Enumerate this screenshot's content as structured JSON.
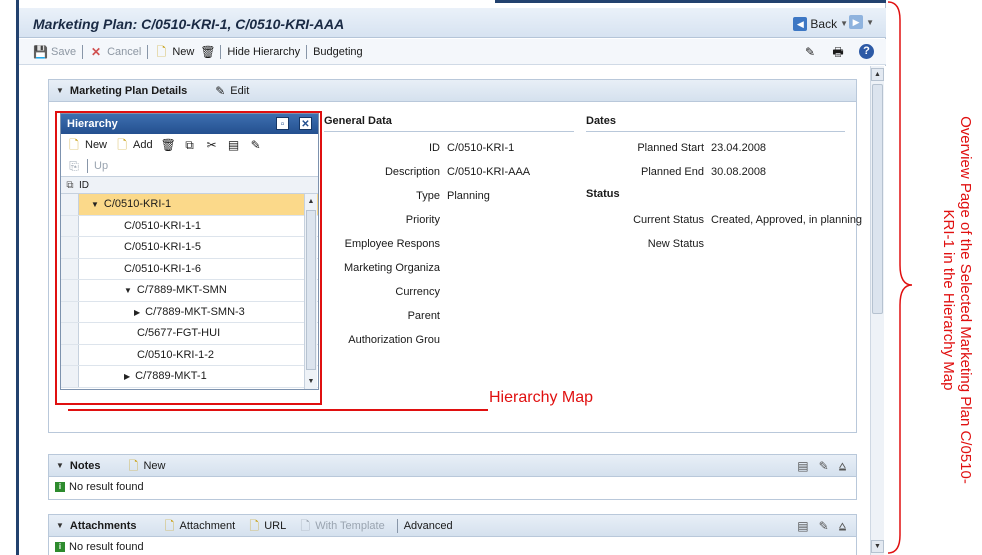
{
  "window": {
    "title": "Marketing Plan: C/0510-KRI-1, C/0510-KRI-AAA",
    "back_label": "Back"
  },
  "toolbar": {
    "save_label": "Save",
    "cancel_label": "Cancel",
    "new_label": "New",
    "hide_hierarchy_label": "Hide Hierarchy",
    "budgeting_label": "Budgeting"
  },
  "details_panel": {
    "title": "Marketing Plan Details",
    "edit_label": "Edit",
    "general_data_title": "General Data",
    "dates_title": "Dates",
    "status_title": "Status",
    "general_fields": [
      {
        "label": "ID",
        "value": "C/0510-KRI-1"
      },
      {
        "label": "Description",
        "value": "C/0510-KRI-AAA"
      },
      {
        "label": "Type",
        "value": "Planning"
      },
      {
        "label": "Priority",
        "value": ""
      },
      {
        "label": "Employee Respons",
        "value": ""
      },
      {
        "label": "Marketing Organiza",
        "value": ""
      },
      {
        "label": "Currency",
        "value": ""
      },
      {
        "label": "Parent",
        "value": ""
      },
      {
        "label": "Authorization Grou",
        "value": ""
      }
    ],
    "date_fields": [
      {
        "label": "Planned Start",
        "value": "23.04.2008"
      },
      {
        "label": "Planned End",
        "value": "30.08.2008"
      }
    ],
    "status_fields": [
      {
        "label": "Current Status",
        "value": "Created, Approved, in planning"
      },
      {
        "label": "New Status",
        "value": ""
      }
    ]
  },
  "hierarchy": {
    "title": "Hierarchy",
    "new_label": "New",
    "add_label": "Add",
    "up_label": "Up",
    "column_header": "ID",
    "rows": [
      {
        "text": "C/0510-KRI-1",
        "arrow": "▼",
        "level": 1,
        "selected": true
      },
      {
        "text": "C/0510-KRI-1-1",
        "arrow": "",
        "level": 2,
        "selected": false
      },
      {
        "text": "C/0510-KRI-1-5",
        "arrow": "",
        "level": 2,
        "selected": false
      },
      {
        "text": "C/0510-KRI-1-6",
        "arrow": "",
        "level": 2,
        "selected": false
      },
      {
        "text": "C/7889-MKT-SMN",
        "arrow": "▼",
        "level": 2,
        "selected": false
      },
      {
        "text": "C/7889-MKT-SMN-3",
        "arrow": "▶",
        "level": 3,
        "selected": false
      },
      {
        "text": "C/5677-FGT-HUI",
        "arrow": "",
        "level": 3,
        "selected": false
      },
      {
        "text": "C/0510-KRI-1-2",
        "arrow": "",
        "level": 3,
        "selected": false
      },
      {
        "text": "C/7889-MKT-1",
        "arrow": "▶",
        "level": 2,
        "selected": false
      }
    ]
  },
  "notes_panel": {
    "title": "Notes",
    "new_label": "New",
    "empty_text": "No result found"
  },
  "attachments_panel": {
    "title": "Attachments",
    "attachment_label": "Attachment",
    "url_label": "URL",
    "with_template_label": "With Template",
    "advanced_label": "Advanced",
    "empty_text": "No result found"
  },
  "annotations": {
    "hierarchy_map": "Hierarchy Map",
    "overview": "Overview Page of the Selected Marketing Plan C/0510-KRI-1 in the Hierarchy Map"
  },
  "colors": {
    "annotation_red": "#e01010",
    "selected_row": "#fbd98a",
    "popup_header": "#24508f"
  }
}
